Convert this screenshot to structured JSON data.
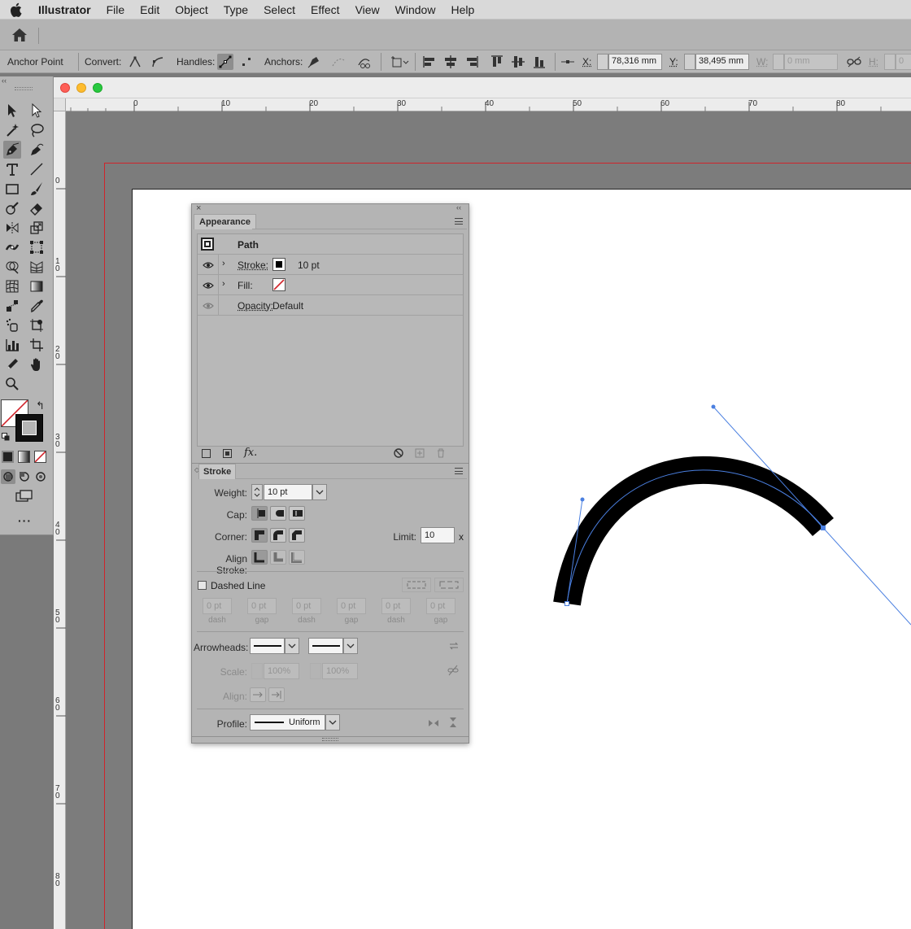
{
  "menubar": {
    "app": "Illustrator",
    "items": [
      "File",
      "Edit",
      "Object",
      "Type",
      "Select",
      "Effect",
      "View",
      "Window",
      "Help"
    ]
  },
  "control": {
    "tool_label": "Anchor Point",
    "convert_label": "Convert:",
    "handles_label": "Handles:",
    "anchors_label": "Anchors:",
    "x_label": "X:",
    "x_value": "78,316 mm",
    "y_label": "Y:",
    "y_value": "38,495 mm",
    "w_label": "W:",
    "w_value": "0 mm",
    "h_label": "H:",
    "h_value": "0"
  },
  "rulers": {
    "h_marks": [
      "0",
      "10",
      "20",
      "30",
      "40",
      "50",
      "60",
      "70",
      "80"
    ],
    "v_marks": [
      "0",
      "10",
      "20",
      "30",
      "40",
      "50",
      "60",
      "70",
      "80"
    ]
  },
  "appearance": {
    "tab": "Appearance",
    "object_type": "Path",
    "stroke_label": "Stroke:",
    "stroke_value": "10 pt",
    "fill_label": "Fill:",
    "opacity_label": "Opacity:",
    "opacity_value": "Default",
    "fx_label": "fx."
  },
  "stroke": {
    "tab": "Stroke",
    "weight_label": "Weight:",
    "weight_value": "10 pt",
    "cap_label": "Cap:",
    "corner_label": "Corner:",
    "limit_label": "Limit:",
    "limit_value": "10",
    "limit_unit": "x",
    "align_label": "Align Stroke:",
    "dashed_label": "Dashed Line",
    "dashed_checked": false,
    "dash_fields": [
      {
        "value": "0 pt",
        "caption": "dash"
      },
      {
        "value": "0 pt",
        "caption": "gap"
      },
      {
        "value": "0 pt",
        "caption": "dash"
      },
      {
        "value": "0 pt",
        "caption": "gap"
      },
      {
        "value": "0 pt",
        "caption": "dash"
      },
      {
        "value": "0 pt",
        "caption": "gap"
      }
    ],
    "arrowheads_label": "Arrowheads:",
    "scale_label": "Scale:",
    "scale_start": "100%",
    "scale_end": "100%",
    "align_arrow_label": "Align:",
    "profile_label": "Profile:",
    "profile_value": "Uniform"
  },
  "colors": {
    "bleed": "#d0232a",
    "path_selection": "#4a7fe0",
    "stroke": "#000000"
  }
}
